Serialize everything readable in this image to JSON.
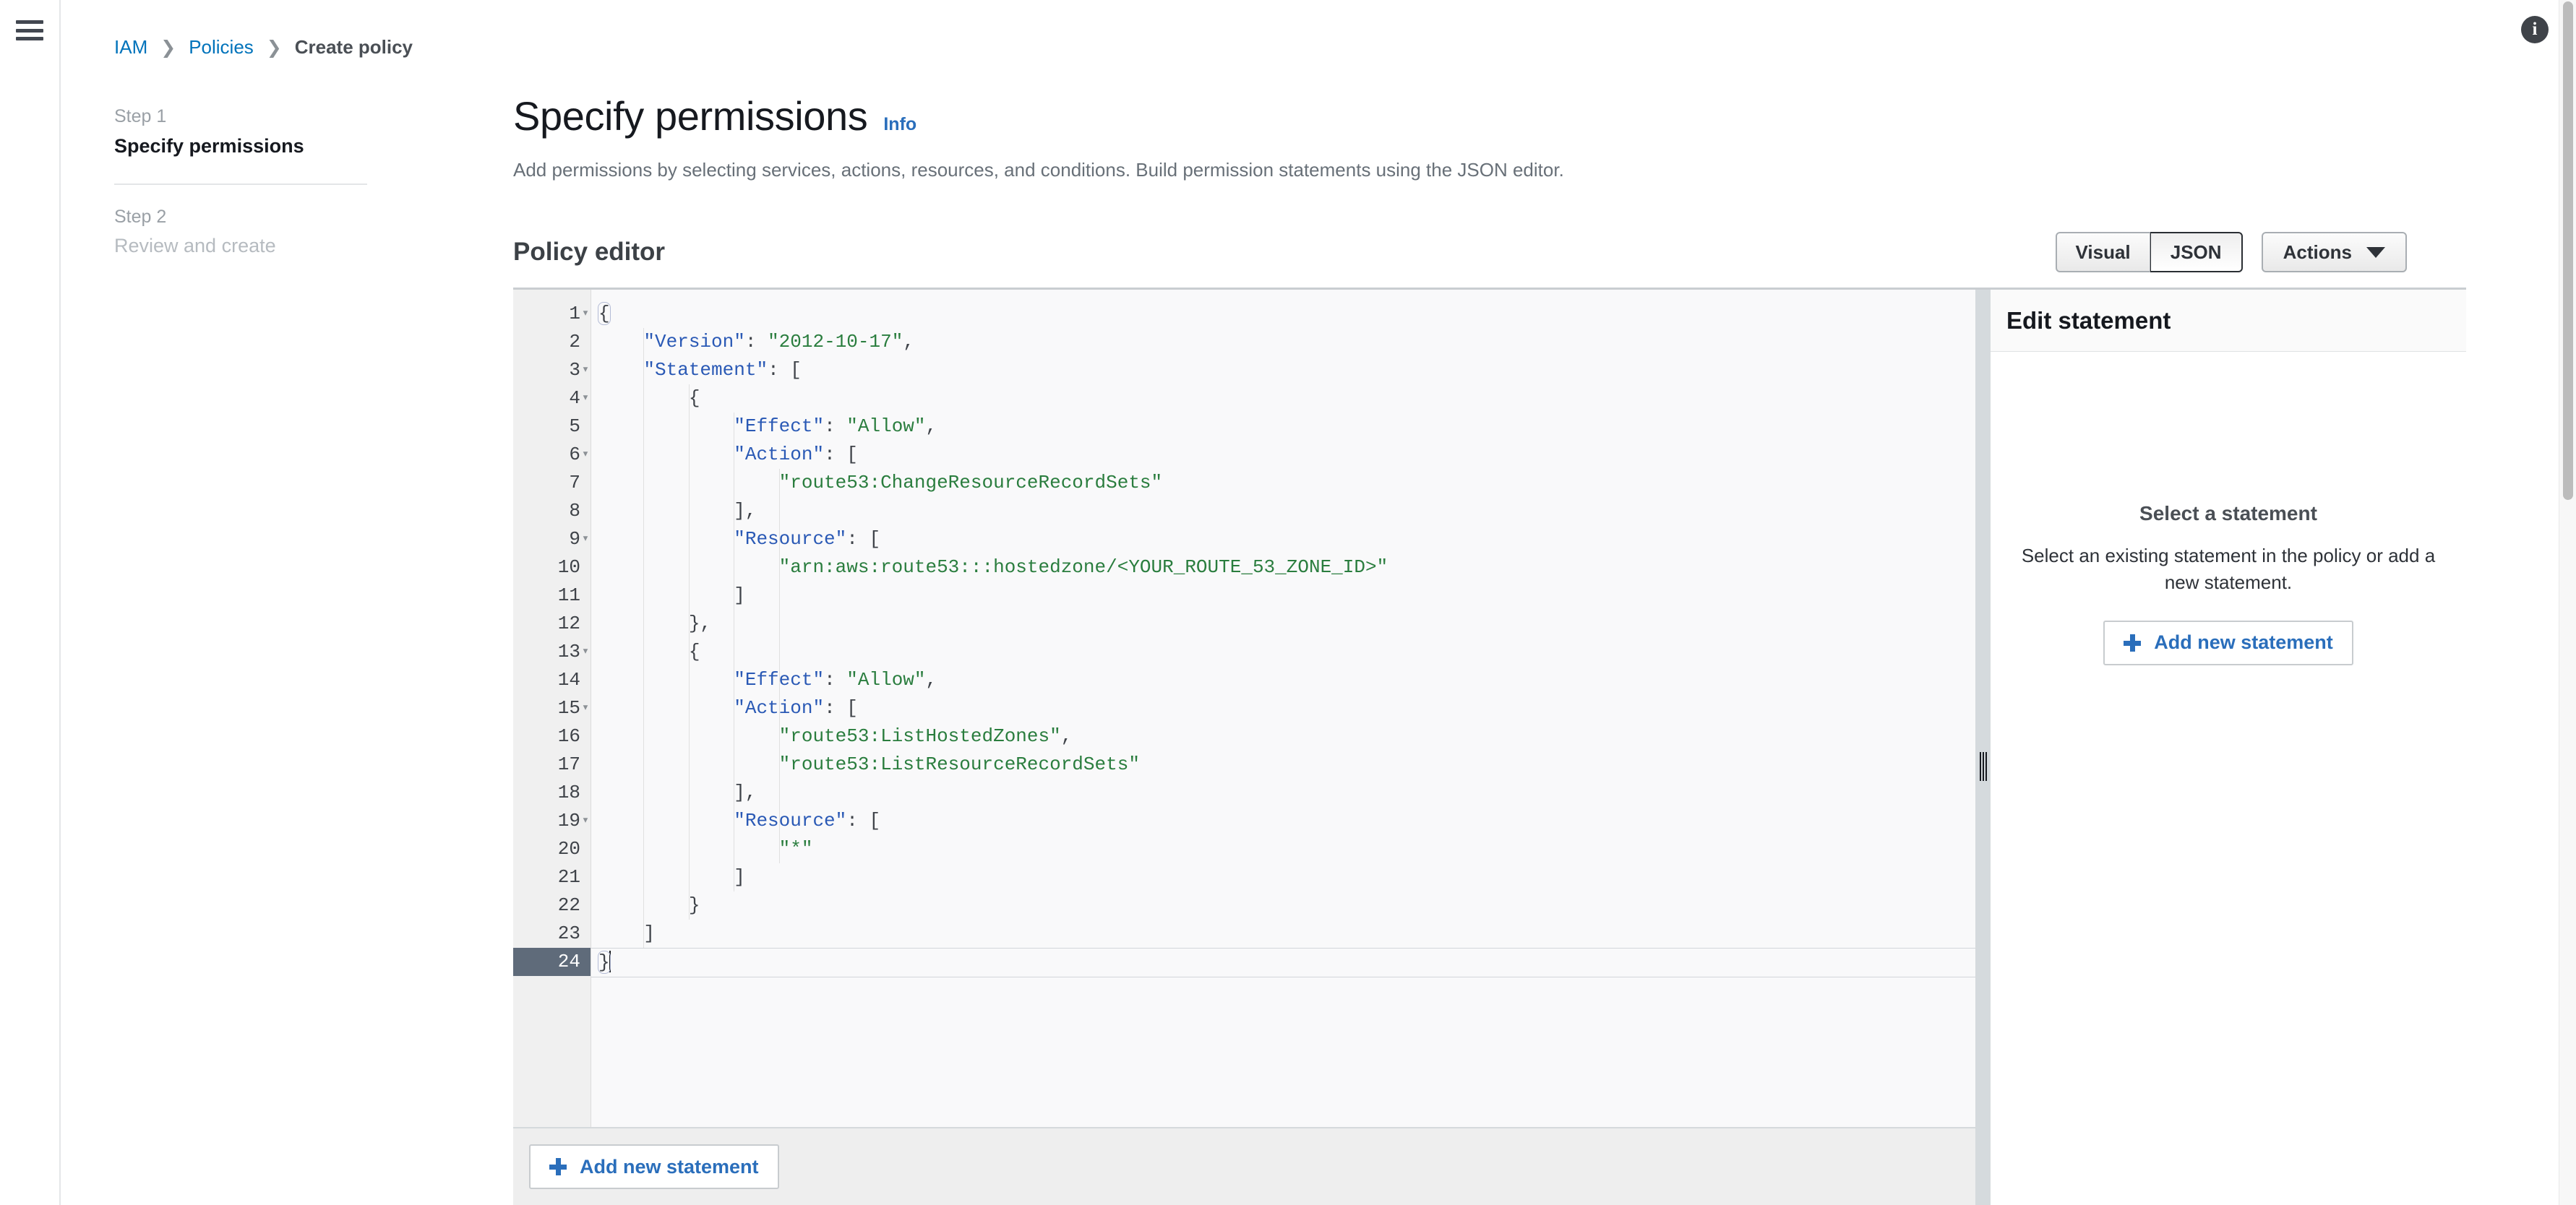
{
  "breadcrumb": {
    "items": [
      {
        "label": "IAM",
        "type": "link"
      },
      {
        "label": "Policies",
        "type": "link"
      },
      {
        "label": "Create policy",
        "type": "current"
      }
    ],
    "separator": "〉"
  },
  "steps": [
    {
      "num": "Step 1",
      "title": "Specify permissions",
      "state": "active"
    },
    {
      "num": "Step 2",
      "title": "Review and create",
      "state": "inactive"
    }
  ],
  "header": {
    "title": "Specify permissions",
    "info_label": "Info",
    "description": "Add permissions by selecting services, actions, resources, and conditions. Build permission statements using the JSON editor."
  },
  "editor": {
    "heading": "Policy editor",
    "view_modes": [
      {
        "label": "Visual",
        "selected": false
      },
      {
        "label": "JSON",
        "selected": true
      }
    ],
    "actions_label": "Actions",
    "add_statement_label": "Add new statement",
    "cursor_line": 24,
    "lines": [
      {
        "n": 1,
        "fold": true,
        "tokens": [
          {
            "t": "p",
            "v": "{"
          }
        ]
      },
      {
        "n": 2,
        "fold": false,
        "tokens": [
          {
            "t": "p",
            "v": "    "
          },
          {
            "t": "k",
            "v": "\"Version\""
          },
          {
            "t": "p",
            "v": ": "
          },
          {
            "t": "s",
            "v": "\"2012-10-17\""
          },
          {
            "t": "p",
            "v": ","
          }
        ]
      },
      {
        "n": 3,
        "fold": true,
        "tokens": [
          {
            "t": "p",
            "v": "    "
          },
          {
            "t": "k",
            "v": "\"Statement\""
          },
          {
            "t": "p",
            "v": ": ["
          }
        ]
      },
      {
        "n": 4,
        "fold": true,
        "tokens": [
          {
            "t": "p",
            "v": "        {"
          }
        ]
      },
      {
        "n": 5,
        "fold": false,
        "tokens": [
          {
            "t": "p",
            "v": "            "
          },
          {
            "t": "k",
            "v": "\"Effect\""
          },
          {
            "t": "p",
            "v": ": "
          },
          {
            "t": "s",
            "v": "\"Allow\""
          },
          {
            "t": "p",
            "v": ","
          }
        ]
      },
      {
        "n": 6,
        "fold": true,
        "tokens": [
          {
            "t": "p",
            "v": "            "
          },
          {
            "t": "k",
            "v": "\"Action\""
          },
          {
            "t": "p",
            "v": ": ["
          }
        ]
      },
      {
        "n": 7,
        "fold": false,
        "tokens": [
          {
            "t": "p",
            "v": "                "
          },
          {
            "t": "s",
            "v": "\"route53:ChangeResourceRecordSets\""
          }
        ]
      },
      {
        "n": 8,
        "fold": false,
        "tokens": [
          {
            "t": "p",
            "v": "            ],"
          }
        ]
      },
      {
        "n": 9,
        "fold": true,
        "tokens": [
          {
            "t": "p",
            "v": "            "
          },
          {
            "t": "k",
            "v": "\"Resource\""
          },
          {
            "t": "p",
            "v": ": ["
          }
        ]
      },
      {
        "n": 10,
        "fold": false,
        "tokens": [
          {
            "t": "p",
            "v": "                "
          },
          {
            "t": "s",
            "v": "\"arn:aws:route53:::hostedzone/<YOUR_ROUTE_53_ZONE_ID>\""
          }
        ]
      },
      {
        "n": 11,
        "fold": false,
        "tokens": [
          {
            "t": "p",
            "v": "            ]"
          }
        ]
      },
      {
        "n": 12,
        "fold": false,
        "tokens": [
          {
            "t": "p",
            "v": "        },"
          }
        ]
      },
      {
        "n": 13,
        "fold": true,
        "tokens": [
          {
            "t": "p",
            "v": "        {"
          }
        ]
      },
      {
        "n": 14,
        "fold": false,
        "tokens": [
          {
            "t": "p",
            "v": "            "
          },
          {
            "t": "k",
            "v": "\"Effect\""
          },
          {
            "t": "p",
            "v": ": "
          },
          {
            "t": "s",
            "v": "\"Allow\""
          },
          {
            "t": "p",
            "v": ","
          }
        ]
      },
      {
        "n": 15,
        "fold": true,
        "tokens": [
          {
            "t": "p",
            "v": "            "
          },
          {
            "t": "k",
            "v": "\"Action\""
          },
          {
            "t": "p",
            "v": ": ["
          }
        ]
      },
      {
        "n": 16,
        "fold": false,
        "tokens": [
          {
            "t": "p",
            "v": "                "
          },
          {
            "t": "s",
            "v": "\"route53:ListHostedZones\""
          },
          {
            "t": "p",
            "v": ","
          }
        ]
      },
      {
        "n": 17,
        "fold": false,
        "tokens": [
          {
            "t": "p",
            "v": "                "
          },
          {
            "t": "s",
            "v": "\"route53:ListResourceRecordSets\""
          }
        ]
      },
      {
        "n": 18,
        "fold": false,
        "tokens": [
          {
            "t": "p",
            "v": "            ],"
          }
        ]
      },
      {
        "n": 19,
        "fold": true,
        "tokens": [
          {
            "t": "p",
            "v": "            "
          },
          {
            "t": "k",
            "v": "\"Resource\""
          },
          {
            "t": "p",
            "v": ": ["
          }
        ]
      },
      {
        "n": 20,
        "fold": false,
        "tokens": [
          {
            "t": "p",
            "v": "                "
          },
          {
            "t": "s",
            "v": "\"*\""
          }
        ]
      },
      {
        "n": 21,
        "fold": false,
        "tokens": [
          {
            "t": "p",
            "v": "            ]"
          }
        ]
      },
      {
        "n": 22,
        "fold": false,
        "tokens": [
          {
            "t": "p",
            "v": "        }"
          }
        ]
      },
      {
        "n": 23,
        "fold": false,
        "tokens": [
          {
            "t": "p",
            "v": "    ]"
          }
        ]
      },
      {
        "n": 24,
        "fold": false,
        "active": true,
        "cursor": true,
        "tokens": [
          {
            "t": "p",
            "v": "}"
          }
        ]
      }
    ]
  },
  "side_panel": {
    "title": "Edit statement",
    "empty_title": "Select a statement",
    "empty_description": "Select an existing statement in the policy or add a new statement.",
    "add_statement_label": "Add new statement"
  },
  "icons": {
    "menu": "hamburger-icon",
    "info_badge": "i",
    "caret": "chevron-down-icon"
  },
  "colors": {
    "link": "#0073bb",
    "accent": "#2a6ebb",
    "json_key": "#2a59b5",
    "json_string": "#2a7d3e",
    "active_line_gutter": "#5f6b7a"
  }
}
